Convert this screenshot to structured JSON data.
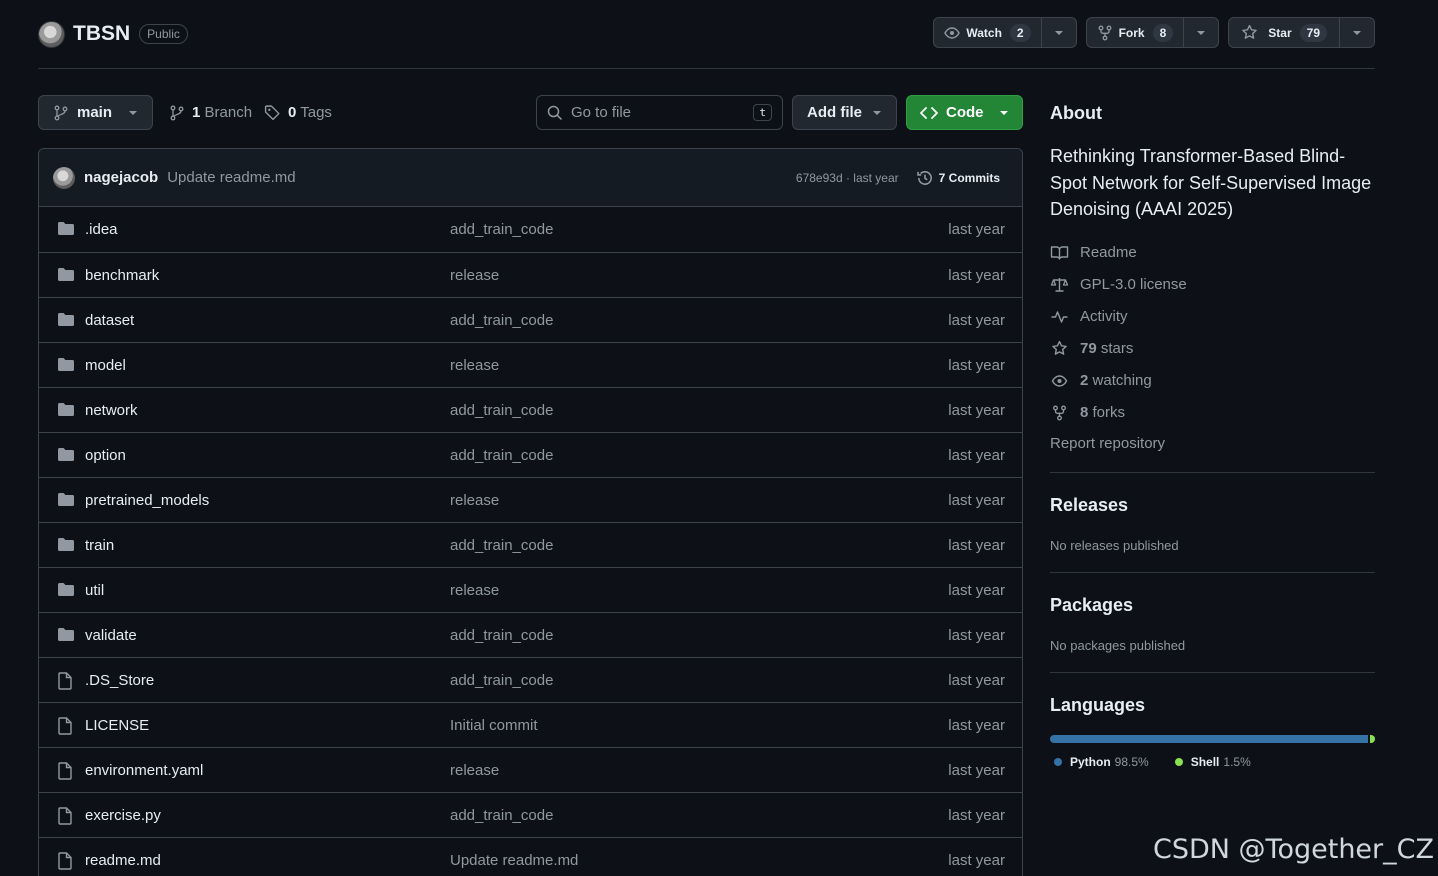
{
  "repo": {
    "name": "TBSN",
    "visibility": "Public"
  },
  "header_actions": {
    "watch": {
      "label": "Watch",
      "count": "2"
    },
    "fork": {
      "label": "Fork",
      "count": "8"
    },
    "star": {
      "label": "Star",
      "count": "79"
    }
  },
  "toolbar": {
    "branch": "main",
    "branches_count": "1",
    "branches_label": "Branch",
    "tags_count": "0",
    "tags_label": "Tags",
    "goto_placeholder": "Go to file",
    "goto_shortcut": "t",
    "add_file": "Add file",
    "code": "Code"
  },
  "latest_commit": {
    "author": "nagejacob",
    "message": "Update readme.md",
    "sha_time": "678e93d · last year",
    "commits": "7 Commits"
  },
  "files": [
    {
      "type": "dir",
      "name": ".idea",
      "message": "add_train_code",
      "date": "last year"
    },
    {
      "type": "dir",
      "name": "benchmark",
      "message": "release",
      "date": "last year"
    },
    {
      "type": "dir",
      "name": "dataset",
      "message": "add_train_code",
      "date": "last year"
    },
    {
      "type": "dir",
      "name": "model",
      "message": "release",
      "date": "last year"
    },
    {
      "type": "dir",
      "name": "network",
      "message": "add_train_code",
      "date": "last year"
    },
    {
      "type": "dir",
      "name": "option",
      "message": "add_train_code",
      "date": "last year"
    },
    {
      "type": "dir",
      "name": "pretrained_models",
      "message": "release",
      "date": "last year"
    },
    {
      "type": "dir",
      "name": "train",
      "message": "add_train_code",
      "date": "last year"
    },
    {
      "type": "dir",
      "name": "util",
      "message": "release",
      "date": "last year"
    },
    {
      "type": "dir",
      "name": "validate",
      "message": "add_train_code",
      "date": "last year"
    },
    {
      "type": "file",
      "name": ".DS_Store",
      "message": "add_train_code",
      "date": "last year"
    },
    {
      "type": "file",
      "name": "LICENSE",
      "message": "Initial commit",
      "date": "last year"
    },
    {
      "type": "file",
      "name": "environment.yaml",
      "message": "release",
      "date": "last year"
    },
    {
      "type": "file",
      "name": "exercise.py",
      "message": "add_train_code",
      "date": "last year"
    },
    {
      "type": "file",
      "name": "readme.md",
      "message": "Update readme.md",
      "date": "last year"
    }
  ],
  "about": {
    "title": "About",
    "description": "Rethinking Transformer-Based Blind-Spot Network for Self-Supervised Image Denoising (AAAI 2025)",
    "readme": "Readme",
    "license": "GPL-3.0 license",
    "activity": "Activity",
    "stars_count": "79",
    "stars_label": "stars",
    "watching_count": "2",
    "watching_label": "watching",
    "forks_count": "8",
    "forks_label": "forks",
    "report": "Report repository"
  },
  "releases": {
    "title": "Releases",
    "note": "No releases published"
  },
  "packages": {
    "title": "Packages",
    "note": "No packages published"
  },
  "languages": {
    "title": "Languages",
    "items": [
      {
        "name": "Python",
        "percent": "98.5%",
        "value": 98.5,
        "color": "#3572a5"
      },
      {
        "name": "Shell",
        "percent": "1.5%",
        "value": 1.5,
        "color": "#89e051"
      }
    ]
  },
  "watermark": "CSDN @Together_CZ"
}
